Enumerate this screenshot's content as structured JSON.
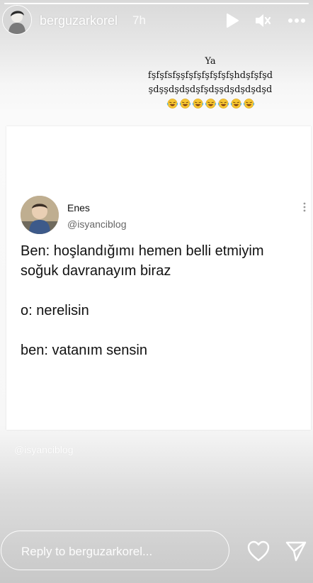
{
  "story": {
    "progress_fraction": 1.0
  },
  "header": {
    "username": "berguzarkorel",
    "time": "7h",
    "avatar_icon": "profile-avatar"
  },
  "caption": {
    "lines": [
      "Ya",
      "fşfşfsfşşfşfşfşfşfşfşhdşfşfşd",
      "şdşşdşdşdşfşdşşdşdşdşdşd"
    ],
    "emoji_count": 7,
    "emoji_icon": "laughing-tears-emoji"
  },
  "tweet": {
    "name": "Enes",
    "handle": "@isyanciblog",
    "paragraphs": [
      "Ben: hoşlandığımı hemen belli etmiyim soğuk davranayım biraz",
      "o: nerelisin",
      "ben: vatanım sensin"
    ]
  },
  "watermark": "@isyanciblog",
  "reply": {
    "placeholder": "Reply to berguzarkorel..."
  },
  "colors": {
    "text": "#111111",
    "handle": "#666666",
    "overlay_white": "#ffffff"
  }
}
